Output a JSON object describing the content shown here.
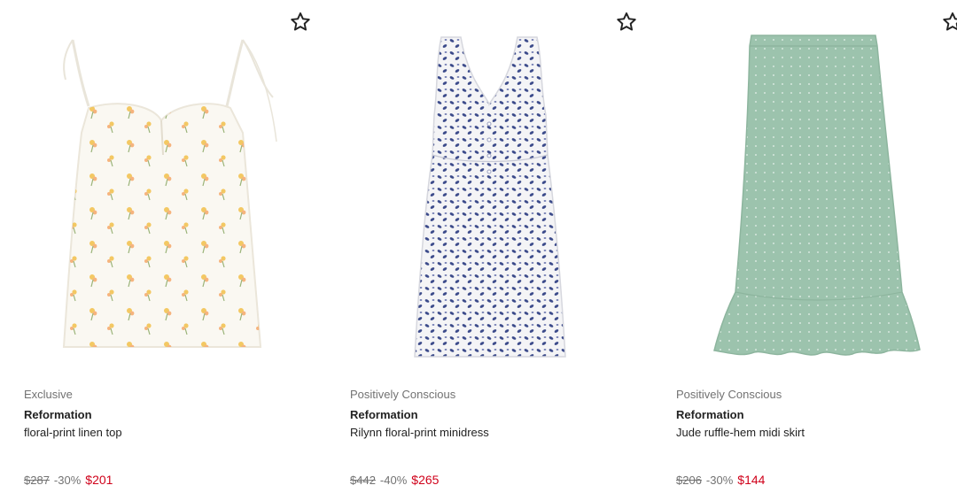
{
  "products": [
    {
      "label": "Exclusive",
      "brand": "Reformation",
      "name": "floral-print linen top",
      "original_price": "$287",
      "discount": "-30%",
      "sale_price": "$201",
      "wishlist_icon": "star-outline-icon"
    },
    {
      "label": "Positively Conscious",
      "brand": "Reformation",
      "name": "Rilynn floral-print minidress",
      "original_price": "$442",
      "discount": "-40%",
      "sale_price": "$265",
      "wishlist_icon": "star-outline-icon"
    },
    {
      "label": "Positively Conscious",
      "brand": "Reformation",
      "name": "Jude ruffle-hem midi skirt",
      "original_price": "$206",
      "discount": "-30%",
      "sale_price": "$144",
      "wishlist_icon": "star-outline-icon"
    }
  ],
  "colors": {
    "sale": "#d0021b",
    "muted": "#727272",
    "text": "#222222",
    "top_fabric": "#faf8f2",
    "dress_print": "#3b4a8a",
    "skirt_fabric": "#9cc3ad"
  }
}
